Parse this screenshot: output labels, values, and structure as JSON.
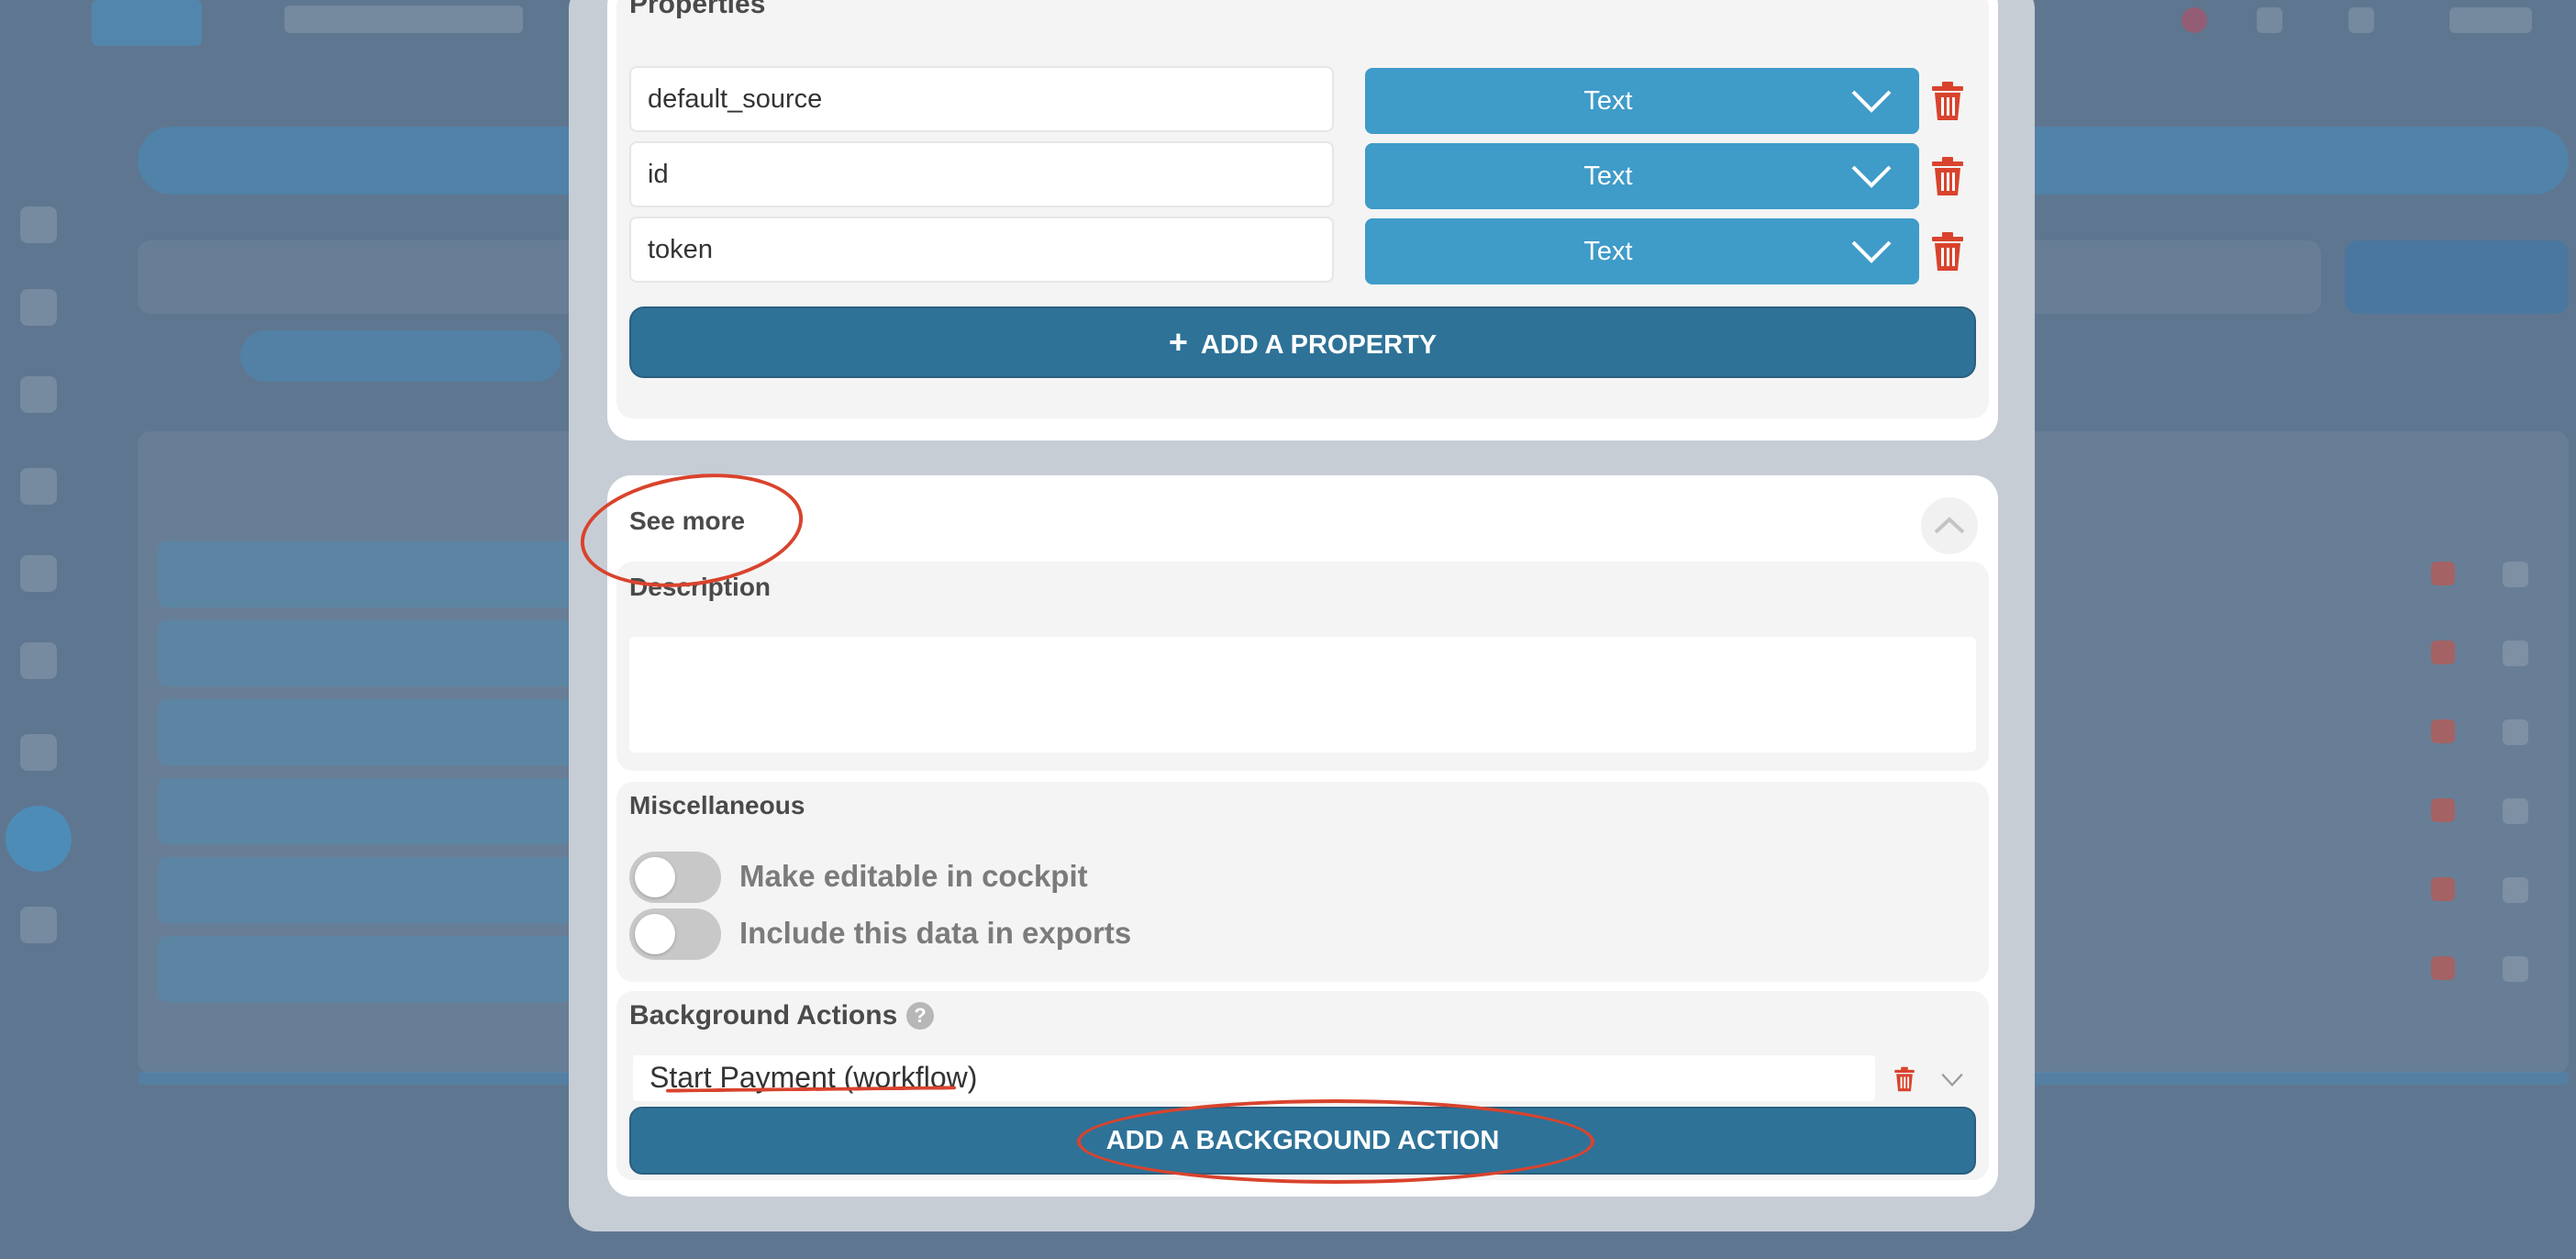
{
  "properties": {
    "heading": "Properties",
    "items": [
      {
        "name": "default_source",
        "type": "Text"
      },
      {
        "name": "id",
        "type": "Text"
      },
      {
        "name": "token",
        "type": "Text"
      }
    ],
    "add_label": "ADD A PROPERTY"
  },
  "see_more": {
    "label": "See more",
    "description_heading": "Description",
    "description_value": "",
    "misc_heading": "Miscellaneous",
    "toggles": [
      {
        "label": "Make editable in cockpit",
        "on": false
      },
      {
        "label": "Include this data in exports",
        "on": false
      }
    ],
    "background_actions_heading": "Background Actions",
    "help_icon": "?",
    "action_value": "Start Payment (workflow)",
    "add_action_label": "ADD A BACKGROUND ACTION"
  },
  "colors": {
    "primary": "#2e7298",
    "select": "#3f9bc8",
    "danger": "#d9432d",
    "overlay": "#5f7690"
  }
}
